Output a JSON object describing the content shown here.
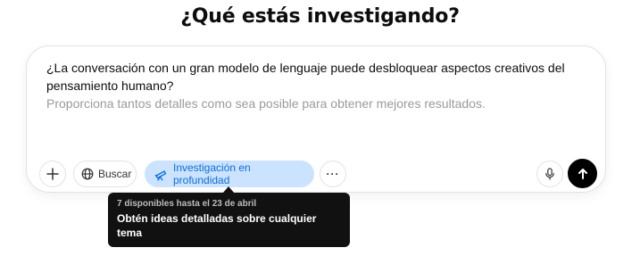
{
  "page": {
    "title": "¿Qué estás investigando?"
  },
  "composer": {
    "prompt_text": "¿La conversación con un gran modelo de lenguaje puede desbloquear aspectos creativos del pensamiento humano?",
    "placeholder": "Proporciona tantos detalles como sea posible para obtener mejores resultados."
  },
  "toolbar": {
    "add_icon": "plus-icon",
    "search_label": "Buscar",
    "search_icon": "globe-icon",
    "deep_research_label": "Investigación en profundidad",
    "deep_research_icon": "telescope-icon",
    "more_icon": "more-icon",
    "more_label": "···",
    "mic_icon": "microphone-icon",
    "send_icon": "arrow-up-icon"
  },
  "tooltip": {
    "meta": "7 disponibles hasta el 23 de abril",
    "body": "Obtén ideas detalladas sobre cualquier tema"
  },
  "colors": {
    "accent_bg": "#cce3ff",
    "accent_text": "#0b6fd8",
    "send_bg": "#000000",
    "tooltip_bg": "#111111"
  }
}
